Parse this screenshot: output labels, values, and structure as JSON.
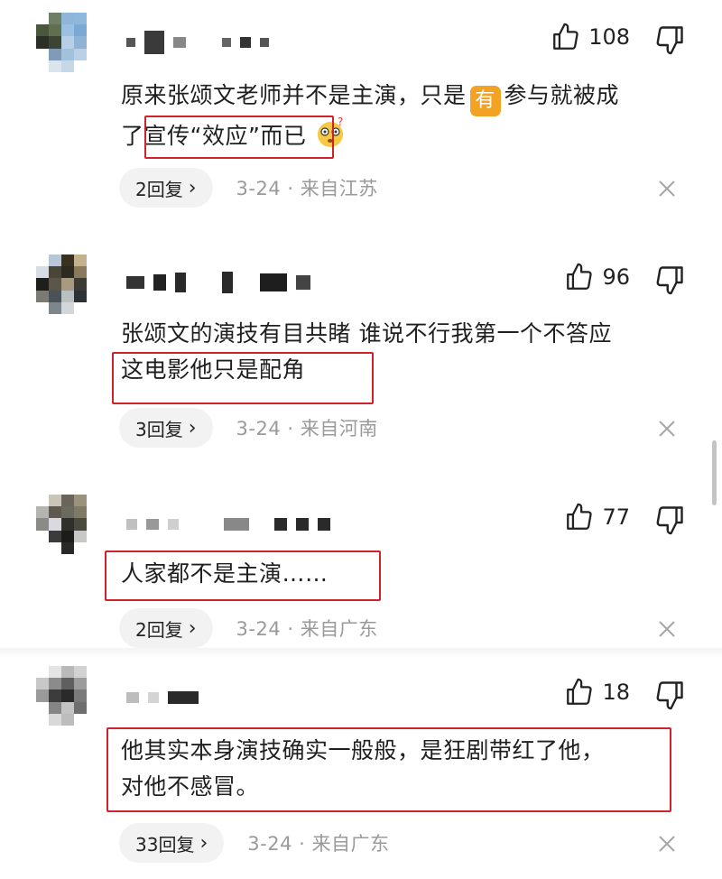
{
  "comments": [
    {
      "likes": "108",
      "text_before": "原来张颂文老师并不是主演，只是",
      "emoji_you": "有",
      "text_after_emoji": "参与就被成",
      "line2_prefix": "了",
      "highlight": "宣传“效应”而已",
      "replies": "2回复",
      "meta": "3-24 · 来自江苏"
    },
    {
      "likes": "96",
      "line1": "张颂文的演技有目共睹 谁说不行我第一个不答应",
      "highlight": "这电影他只是配角",
      "replies": "3回复",
      "meta": "3-24 · 来自河南"
    },
    {
      "likes": "77",
      "highlight": "人家都不是主演……",
      "replies": "2回复",
      "meta": "3-24 · 来自广东"
    },
    {
      "likes": "18",
      "highlight_line1": "他其实本身演技确实一般般，是狂剧带红了他，",
      "highlight_line2": "对他不感冒。",
      "replies": "33回复",
      "meta": "3-24 · 来自广东"
    }
  ],
  "icons": {
    "like": "thumbs-up-icon",
    "dislike": "thumbs-down-icon",
    "close": "close-icon",
    "reply_chevron": "chevron-right-icon"
  },
  "colors": {
    "highlight_border": "#d0222a",
    "emoji_badge": "#f3a223",
    "meta_text": "#9a9a9a"
  }
}
